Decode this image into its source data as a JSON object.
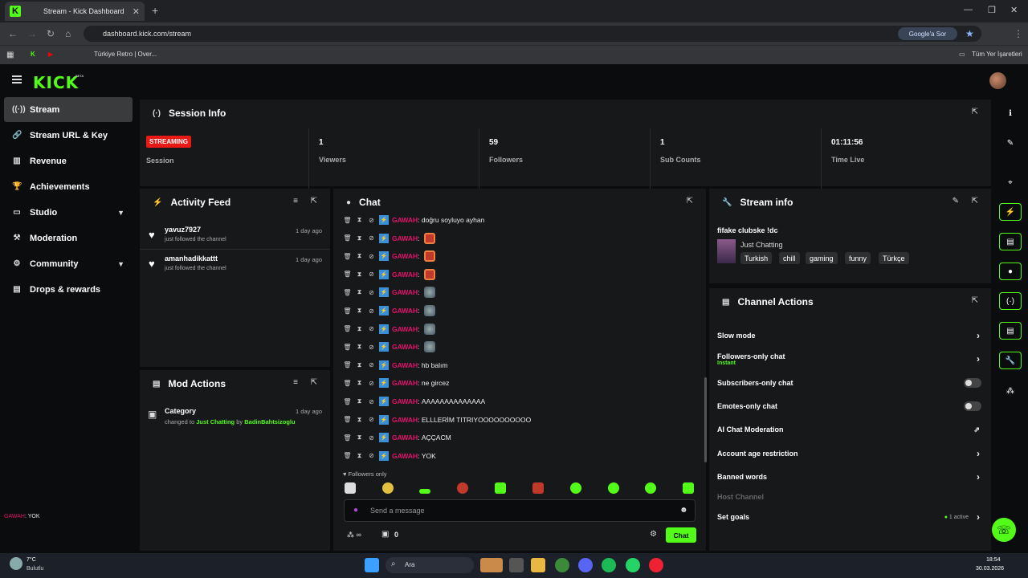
{
  "browser": {
    "tab_title": "Stream - Kick Dashboard",
    "url": "dashboard.kick.com/stream",
    "google_ask": "Google'a Sor",
    "bookmark": "Türkiye Retro | Over...",
    "all_bookmarks": "Tüm Yer İşaretleri"
  },
  "brand": {
    "logo": "KICK",
    "beta": "BETA",
    "accent": "#53fc18"
  },
  "sidebar": {
    "items": [
      {
        "label": "Stream",
        "icon": "broadcast-icon"
      },
      {
        "label": "Stream URL & Key",
        "icon": "link-icon"
      },
      {
        "label": "Revenue",
        "icon": "chart-icon"
      },
      {
        "label": "Achievements",
        "icon": "trophy-icon"
      },
      {
        "label": "Studio",
        "icon": "studio-icon"
      },
      {
        "label": "Moderation",
        "icon": "hammer-icon"
      },
      {
        "label": "Community",
        "icon": "community-icon"
      },
      {
        "label": "Drops & rewards",
        "icon": "gift-icon"
      }
    ],
    "overlay_user": "GAWAH",
    "overlay_text": "YOK"
  },
  "session": {
    "title": "Session Info",
    "status": "STREAMING",
    "status_label": "Session",
    "stats": [
      {
        "value": "1",
        "label": "Viewers"
      },
      {
        "value": "59",
        "label": "Followers"
      },
      {
        "value": "1",
        "label": "Sub Counts"
      },
      {
        "value": "01:11:56",
        "label": "Time Live"
      }
    ]
  },
  "activity": {
    "title": "Activity Feed",
    "items": [
      {
        "name": "yavuz7927",
        "sub": "just followed the channel",
        "time": "1 day ago"
      },
      {
        "name": "amanhadikkattt",
        "sub": "just followed the channel",
        "time": "1 day ago"
      }
    ]
  },
  "mod_actions": {
    "title": "Mod Actions",
    "item": {
      "title": "Category",
      "prefix": "changed to",
      "target": "Just Chatting",
      "by": "by",
      "mod": "BadinBahtsizoglu",
      "time": "1 day ago"
    }
  },
  "chat": {
    "title": "Chat",
    "user": "GAWAH",
    "messages": [
      {
        "text": "doğru soyluyo ayhan",
        "emote": ""
      },
      {
        "text": "",
        "emote": "red"
      },
      {
        "text": "",
        "emote": "red"
      },
      {
        "text": "",
        "emote": "red"
      },
      {
        "text": "",
        "emote": "grey"
      },
      {
        "text": "",
        "emote": "grey"
      },
      {
        "text": "",
        "emote": "grey"
      },
      {
        "text": "",
        "emote": "grey"
      },
      {
        "text": "hb balım",
        "emote": ""
      },
      {
        "text": "ne gircez",
        "emote": ""
      },
      {
        "text": "AAAAAAAAAAAAAA",
        "emote": ""
      },
      {
        "text": "ELLLERİM TITRIYOOOOOOOOOO",
        "emote": ""
      },
      {
        "text": "AÇÇACM",
        "emote": ""
      },
      {
        "text": "YOK",
        "emote": ""
      }
    ],
    "followers_only": "Followers only",
    "placeholder": "Send a message",
    "points": "0",
    "send_label": "Chat"
  },
  "stream_info": {
    "title": "Stream info",
    "stream_title": "fifake clubske !dc",
    "category": "Just Chatting",
    "tags": [
      "Turkish",
      "chill",
      "gaming",
      "funny",
      "Türkçe"
    ]
  },
  "channel_actions": {
    "title": "Channel Actions",
    "rows": [
      {
        "label": "Slow mode",
        "control": "arrow"
      },
      {
        "label": "Followers-only chat",
        "sub": "Instant",
        "control": "arrow"
      },
      {
        "label": "Subscribers-only chat",
        "control": "toggle"
      },
      {
        "label": "Emotes-only chat",
        "control": "toggle"
      },
      {
        "label": "AI Chat Moderation",
        "control": "external"
      },
      {
        "label": "Account age restriction",
        "control": "arrow"
      },
      {
        "label": "Banned words",
        "control": "arrow"
      },
      {
        "label": "Host Channel",
        "control": "none"
      },
      {
        "label": "Set goals",
        "badge": "1 active",
        "control": "arrow"
      }
    ]
  },
  "taskbar": {
    "weather_temp": "7°C",
    "weather_desc": "Bulutlu",
    "search": "Ara",
    "time": "18:54",
    "date": "30.03.2026"
  }
}
